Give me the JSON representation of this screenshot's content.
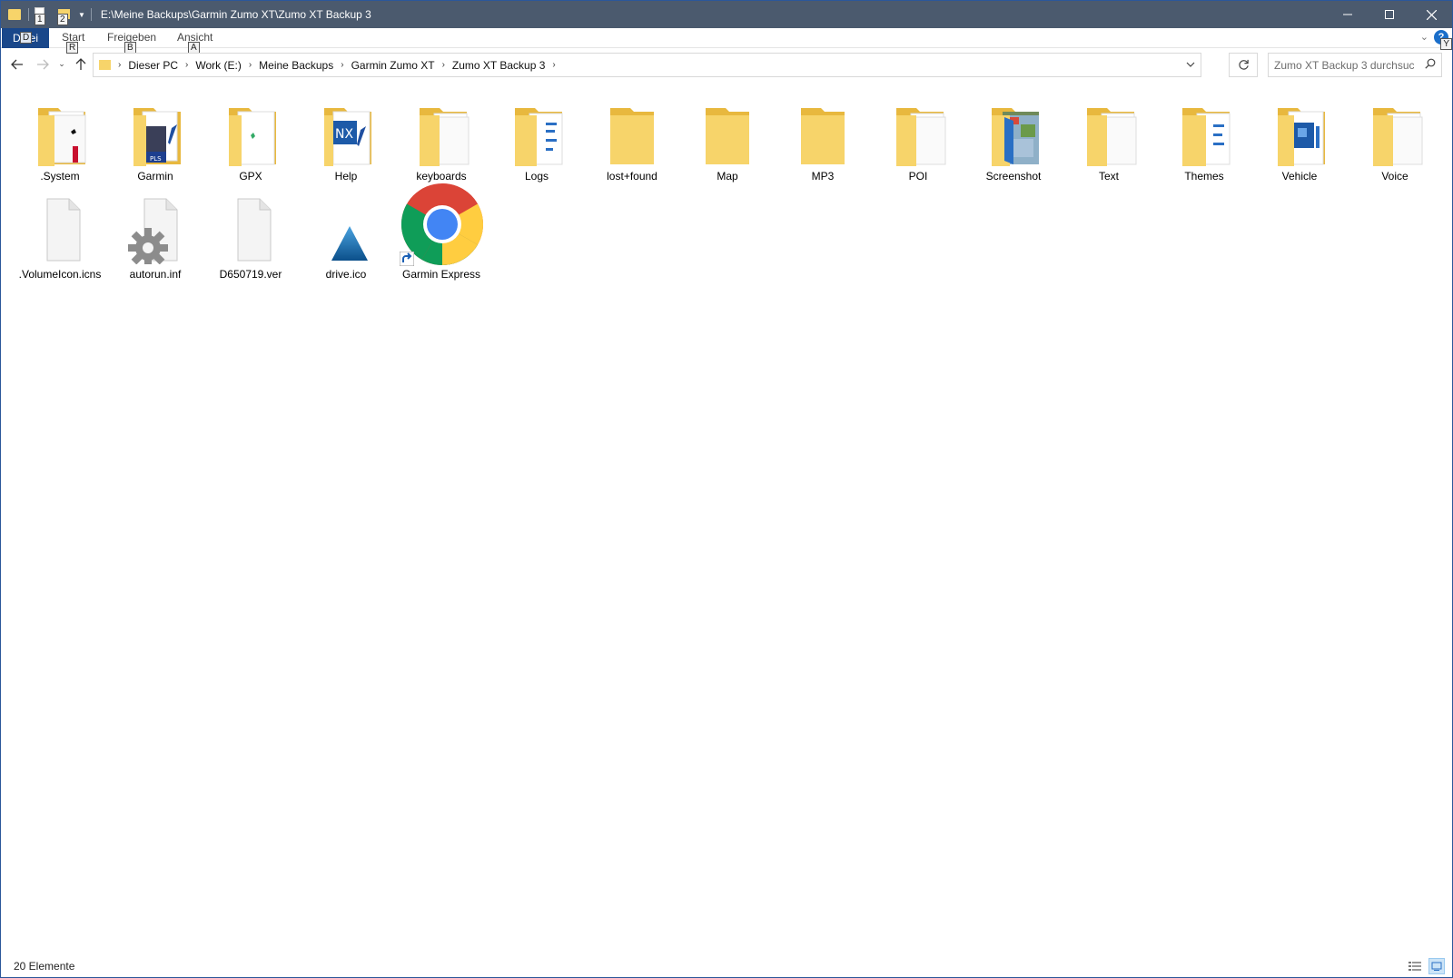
{
  "window": {
    "title": "E:\\Meine Backups\\Garmin Zumo XT\\Zumo XT Backup 3",
    "qat_keytips": [
      "1",
      "2"
    ],
    "controls": {
      "minimize": "—",
      "maximize": "☐",
      "close": "✕"
    },
    "corner_keytip": "Y"
  },
  "ribbon": {
    "tabs": [
      {
        "label": "Datei",
        "keytip": "D"
      },
      {
        "label": "Start",
        "keytip": "R"
      },
      {
        "label": "Freigeben",
        "keytip": "B"
      },
      {
        "label": "Ansicht",
        "keytip": "A"
      }
    ],
    "help": "?"
  },
  "address": {
    "breadcrumbs": [
      "Dieser PC",
      "Work (E:)",
      "Meine Backups",
      "Garmin Zumo XT",
      "Zumo XT Backup 3"
    ],
    "search_placeholder": "Zumo XT Backup 3 durchsuch..."
  },
  "items": [
    {
      "name": ".System",
      "kind": "folder",
      "preview": "system"
    },
    {
      "name": "Garmin",
      "kind": "folder",
      "preview": "garmin"
    },
    {
      "name": "GPX",
      "kind": "folder",
      "preview": "gpx"
    },
    {
      "name": "Help",
      "kind": "folder",
      "preview": "help"
    },
    {
      "name": "keyboards",
      "kind": "folder",
      "preview": "docs"
    },
    {
      "name": "Logs",
      "kind": "folder",
      "preview": "logs"
    },
    {
      "name": "lost+found",
      "kind": "folder",
      "preview": "empty"
    },
    {
      "name": "Map",
      "kind": "folder",
      "preview": "empty"
    },
    {
      "name": "MP3",
      "kind": "folder",
      "preview": "empty"
    },
    {
      "name": "POI",
      "kind": "folder",
      "preview": "docs"
    },
    {
      "name": "Screenshot",
      "kind": "folder",
      "preview": "screenshot"
    },
    {
      "name": "Text",
      "kind": "folder",
      "preview": "docs"
    },
    {
      "name": "Themes",
      "kind": "folder",
      "preview": "themes"
    },
    {
      "name": "Vehicle",
      "kind": "folder",
      "preview": "vehicle"
    },
    {
      "name": "Voice",
      "kind": "folder",
      "preview": "docs"
    },
    {
      "name": ".VolumeIcon.icns",
      "kind": "file",
      "preview": "blank"
    },
    {
      "name": "autorun.inf",
      "kind": "file",
      "preview": "gear"
    },
    {
      "name": "D650719.ver",
      "kind": "file",
      "preview": "blank"
    },
    {
      "name": "drive.ico",
      "kind": "file",
      "preview": "garmin-triangle"
    },
    {
      "name": "Garmin Express",
      "kind": "shortcut",
      "preview": "chrome"
    }
  ],
  "status": {
    "count_text": "20 Elemente"
  },
  "colors": {
    "titlebar": "#4b5a6e",
    "file_tab": "#19478a",
    "folder": "#f7d46a",
    "folder_dark": "#e8b83e"
  }
}
